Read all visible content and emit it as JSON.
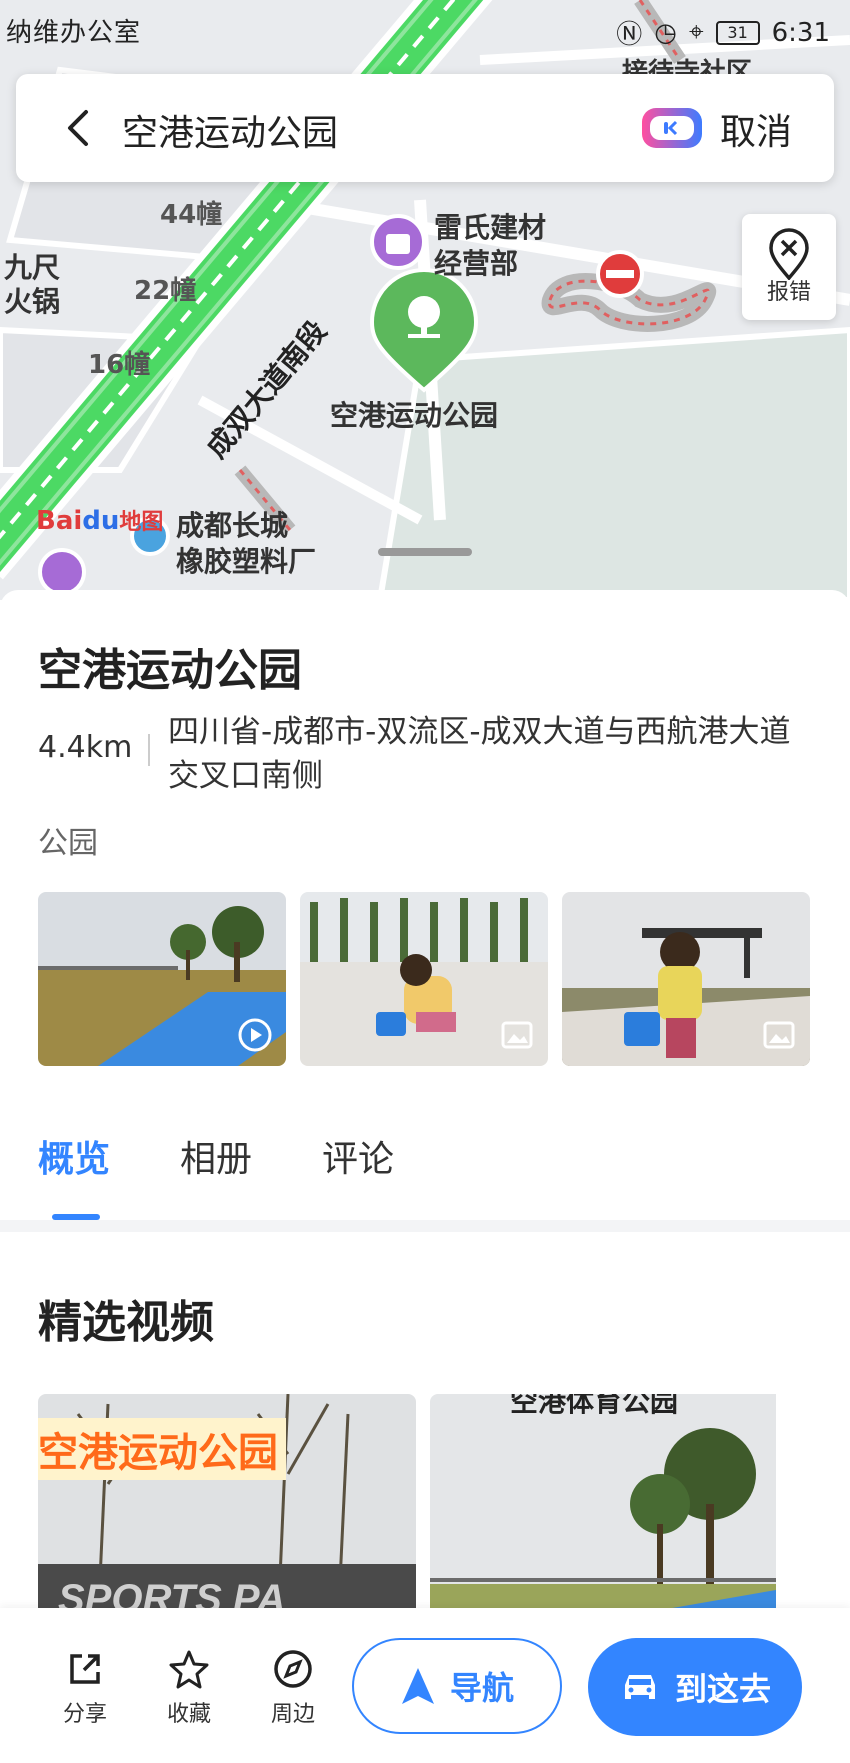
{
  "status_bar": {
    "left_text": "纳维办公室",
    "time": "6:31",
    "battery": "31"
  },
  "search": {
    "query": "空港运动公园",
    "cancel_label": "取消"
  },
  "map": {
    "report_label": "报错",
    "labels": {
      "building_44": "44幢",
      "building_22": "22幢",
      "building_16": "16幢",
      "poi_left_1": "九尺",
      "poi_left_2": "火锅",
      "poi_store_1": "雷氏建材",
      "poi_store_2": "经营部",
      "marker_name": "空港运动公园",
      "road": "成双大道南段",
      "factory_1": "成都长城",
      "factory_2": "橡胶塑料厂",
      "community": "接待寺社区"
    },
    "logo_text": "Bai地图"
  },
  "place": {
    "name": "空港运动公园",
    "distance": "4.4km",
    "address": "四川省-成都市-双流区-成双大道与西航港大道交叉口南侧",
    "category": "公园"
  },
  "tabs": [
    {
      "label": "概览",
      "active": true
    },
    {
      "label": "相册",
      "active": false
    },
    {
      "label": "评论",
      "active": false
    }
  ],
  "featured": {
    "title": "精选视频",
    "video1_overlay": "空港运动公园",
    "video2_caption": "空港体育公园"
  },
  "bottom_bar": {
    "share_label": "分享",
    "favorite_label": "收藏",
    "nearby_label": "周边",
    "navigate_label": "导航",
    "go_label": "到这去"
  },
  "colors": {
    "accent": "#3385ff",
    "map_bg": "#e9ebee",
    "road_green": "#4cd964",
    "marker_green": "#5cb85c"
  }
}
